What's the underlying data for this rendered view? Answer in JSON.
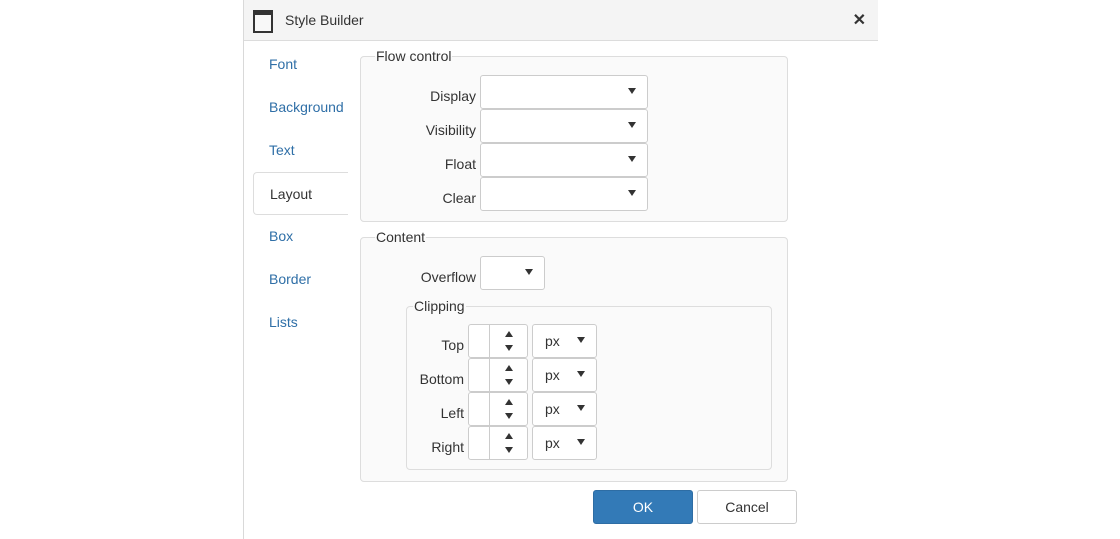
{
  "dialog": {
    "title": "Style Builder",
    "icon": "window-icon",
    "close_icon": "close-icon"
  },
  "nav": {
    "items": [
      {
        "label": "Font",
        "active": false
      },
      {
        "label": "Background",
        "active": false
      },
      {
        "label": "Text",
        "active": false
      },
      {
        "label": "Layout",
        "active": true
      },
      {
        "label": "Box",
        "active": false
      },
      {
        "label": "Border",
        "active": false
      },
      {
        "label": "Lists",
        "active": false
      }
    ]
  },
  "flow_control": {
    "legend": "Flow control",
    "fields": [
      {
        "label": "Display",
        "value": ""
      },
      {
        "label": "Visibility",
        "value": ""
      },
      {
        "label": "Float",
        "value": ""
      },
      {
        "label": "Clear",
        "value": ""
      }
    ]
  },
  "content": {
    "legend": "Content",
    "overflow": {
      "label": "Overflow",
      "value": ""
    },
    "clipping": {
      "legend": "Clipping",
      "fields": [
        {
          "label": "Top",
          "value": "",
          "unit": "px"
        },
        {
          "label": "Bottom",
          "value": "",
          "unit": "px"
        },
        {
          "label": "Left",
          "value": "",
          "unit": "px"
        },
        {
          "label": "Right",
          "value": "",
          "unit": "px"
        }
      ]
    }
  },
  "buttons": {
    "ok": "OK",
    "cancel": "Cancel"
  },
  "colors": {
    "primary": "#337ab7",
    "link": "#2f6fa7"
  }
}
